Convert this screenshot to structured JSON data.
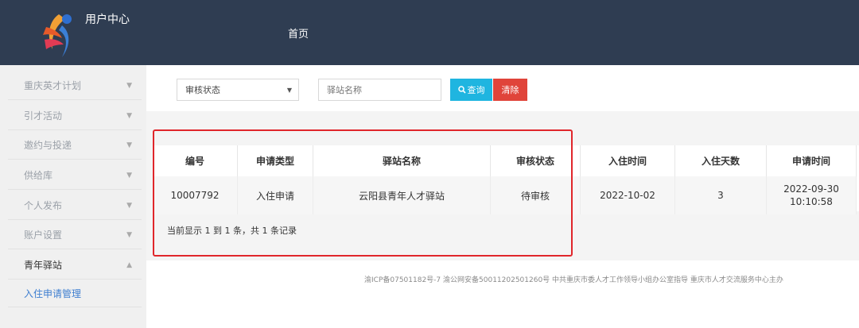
{
  "header": {
    "app_title": "用户中心",
    "nav_home": "首页",
    "logo_icon": "flame-figure-logo"
  },
  "sidebar": {
    "items": [
      {
        "label": "重庆英才计划",
        "state": "collapsed"
      },
      {
        "label": "引才活动",
        "state": "collapsed"
      },
      {
        "label": "邀约与投递",
        "state": "collapsed"
      },
      {
        "label": "供给库",
        "state": "collapsed"
      },
      {
        "label": "个人发布",
        "state": "collapsed"
      },
      {
        "label": "账户设置",
        "state": "collapsed"
      },
      {
        "label": "青年驿站",
        "state": "expanded"
      }
    ],
    "sub_item": "入住申请管理"
  },
  "filters": {
    "status_select": "审核状态",
    "station_placeholder": "驿站名称",
    "query_label": "查询",
    "clear_label": "清除"
  },
  "table": {
    "columns": [
      "编号",
      "申请类型",
      "驿站名称",
      "审核状态",
      "入住时间",
      "入住天数",
      "申请时间"
    ],
    "rows": [
      {
        "id": "10007792",
        "type": "入住申请",
        "station": "云阳县青年人才驿站",
        "status": "待审核",
        "checkin": "2022-10-02",
        "days": "3",
        "applied_date": "2022-09-30",
        "applied_time": "10:10:58"
      }
    ],
    "summary": "当前显示 1 到 1 条，共 1 条记录"
  },
  "footer": {
    "text": "渝ICP备07501182号-7  渝公网安备50011202501260号  中共重庆市委人才工作领导小组办公室指导  重庆市人才交流服务中心主办"
  },
  "colors": {
    "header_bg": "#2f3d52",
    "query_btn": "#1fb5e0",
    "clear_btn": "#e0443a",
    "highlight_border": "#e0262b",
    "sub_item": "#3f7fd0"
  }
}
